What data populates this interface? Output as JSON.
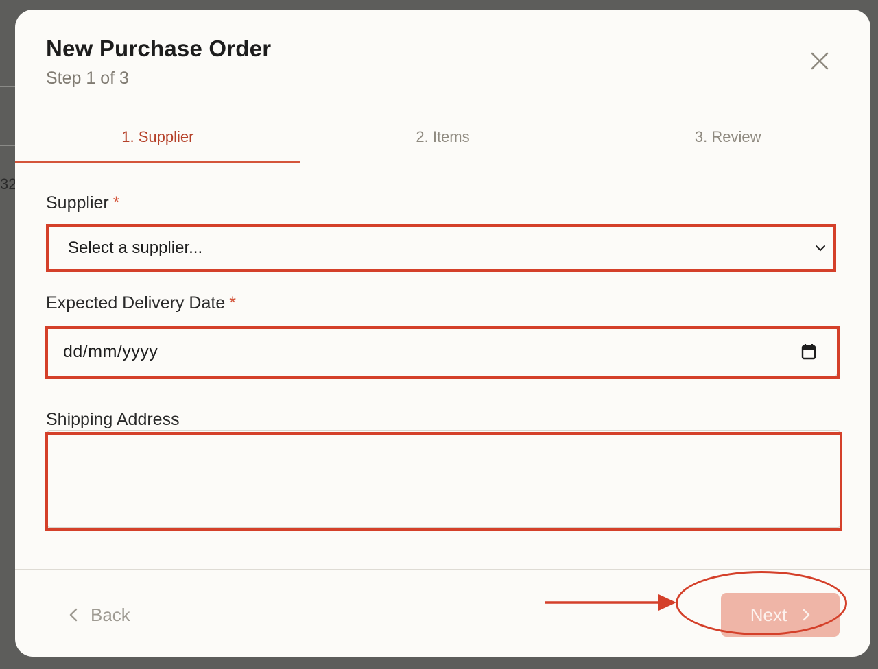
{
  "background": {
    "fragment_text": "32"
  },
  "modal": {
    "title": "New Purchase Order",
    "subtitle": "Step 1 of 3",
    "close_icon": "close-icon"
  },
  "tabs": [
    {
      "label": "1. Supplier",
      "active": true
    },
    {
      "label": "2. Items",
      "active": false
    },
    {
      "label": "3. Review",
      "active": false
    }
  ],
  "form": {
    "supplier": {
      "label": "Supplier",
      "required_mark": "*",
      "selected_value": "Select a supplier..."
    },
    "delivery_date": {
      "label": "Expected Delivery Date",
      "required_mark": "*",
      "placeholder": "dd/mm/yyyy"
    },
    "shipping_address": {
      "label": "Shipping Address",
      "value": ""
    }
  },
  "footer": {
    "back_label": "Back",
    "next_label": "Next"
  },
  "colors": {
    "accent": "#d4553b",
    "highlight": "#d4402a",
    "next_button_disabled": "#efb5a7"
  }
}
